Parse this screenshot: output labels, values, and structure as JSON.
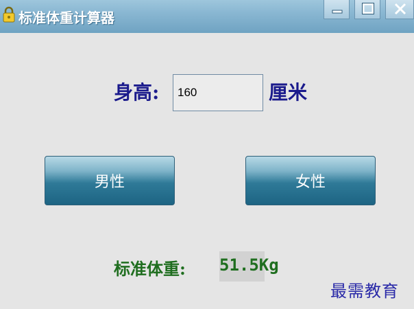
{
  "window": {
    "title": "标准体重计算器",
    "icons": {
      "app": "lock-icon",
      "minimize": "minimize-icon",
      "maximize": "maximize-icon",
      "close": "close-icon"
    }
  },
  "form": {
    "height_label": "身高:",
    "height_value": "160",
    "height_unit": "厘米"
  },
  "buttons": {
    "male_label": "男性",
    "female_label": "女性"
  },
  "result": {
    "label": "标准体重:",
    "value": "51.5Kg"
  },
  "watermark": "最需教育",
  "colors": {
    "label_blue": "#1a1a8c",
    "result_green": "#1f6e1f",
    "titlebar": "#8bb8d3"
  }
}
